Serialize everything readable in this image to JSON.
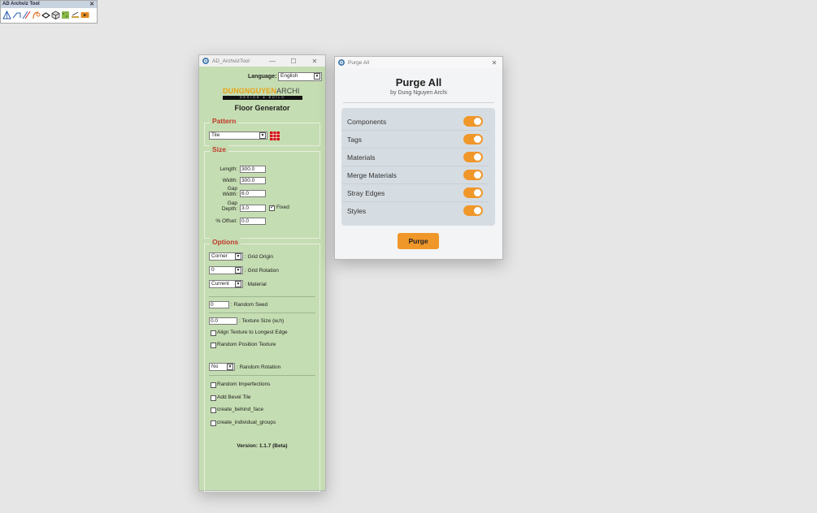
{
  "floor_window": {
    "title": "AD_ArchvizTool",
    "controls": {
      "minimize": "—",
      "maximize": "☐",
      "close": "✕"
    },
    "language_label": "Language:",
    "language_value": "English",
    "logo_text_1": "DUNGNGUYEN",
    "logo_text_2": "ARCHI",
    "logo_tagline": "DESIGN & BUILD",
    "heading": "Floor Generator",
    "pattern": {
      "title": "Pattern",
      "value": "Tile"
    },
    "size": {
      "title": "Size",
      "length_label": "Length:",
      "length_value": "300.0",
      "width_label": "Width:",
      "width_value": "300.0",
      "gap_width_label_1": "Gap",
      "gap_width_label_2": "Width:",
      "gap_width_value": "6.0",
      "gap_depth_label_1": "Gap",
      "gap_depth_label_2": "Depth:",
      "gap_depth_value": "3.0",
      "fixed_label": "Fixed",
      "offset_label": "% Offset:",
      "offset_value": "0.0"
    },
    "options": {
      "title": "Options",
      "grid_origin_value": "Corner",
      "grid_origin_label": ": Grid Origin",
      "grid_rotation_value": "0",
      "grid_rotation_label": ": Grid Rotation",
      "material_value": "Current",
      "material_label": ": Material",
      "random_seed_value": "0",
      "random_seed_label": ": Random Seed",
      "texture_size_value": "0.0",
      "texture_size_label": ": Texture Size (w,h)",
      "align_texture_label": "Align Texture to Longest Edge",
      "random_position_label": "Random Position Texture",
      "random_rotation_value": "No",
      "random_rotation_label": ": Random Rotation",
      "random_imperfections_label": "Random Imperfections",
      "add_bevel_label": "Add Bevel Tile",
      "create_behind_label": "create_behind_face",
      "create_groups_label": "create_individual_groups"
    },
    "version": "Version: 1.1.7 (Beta)"
  },
  "purge_window": {
    "title": "Purge All",
    "close": "✕",
    "heading": "Purge All",
    "subtitle": "by Dung Nguyen Archi",
    "items": [
      {
        "label": "Components",
        "on": true
      },
      {
        "label": "Tags",
        "on": true
      },
      {
        "label": "Materials",
        "on": true
      },
      {
        "label": "Merge Materials",
        "on": true
      },
      {
        "label": "Stray Edges",
        "on": true
      },
      {
        "label": "Styles",
        "on": true
      }
    ],
    "button": "Purge",
    "accent": "#f0972a"
  },
  "toolbar": {
    "title": "AD Archviz Tool",
    "close": "✕",
    "icons": [
      "roof-icon",
      "wall-line-icon",
      "stair-icon",
      "arc-icon",
      "edge-icon",
      "cube-icon",
      "grass-icon",
      "ruler-icon",
      "play-icon"
    ]
  }
}
